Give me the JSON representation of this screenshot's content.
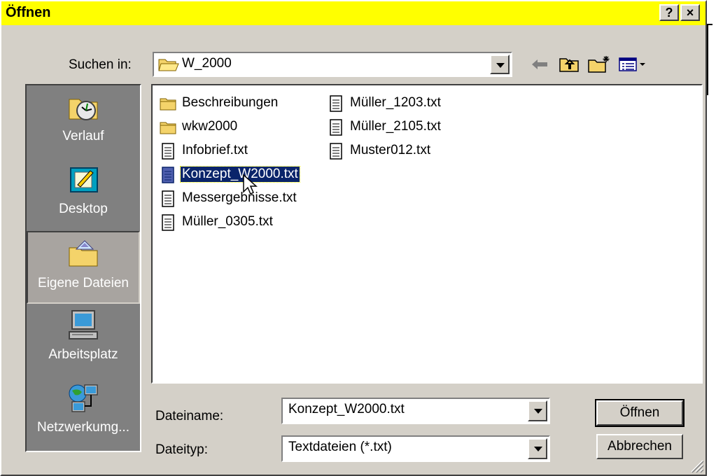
{
  "window": {
    "title": "Öffnen",
    "help_label": "?",
    "close_label": "×"
  },
  "lookin": {
    "label": "Suchen in:",
    "value": "W_2000"
  },
  "toolbar": {
    "icons": [
      "back-arrow-icon",
      "up-folder-icon",
      "new-folder-icon",
      "view-menu-icon"
    ]
  },
  "places": [
    {
      "label": "Verlauf",
      "icon": "history-icon"
    },
    {
      "label": "Desktop",
      "icon": "desktop-icon"
    },
    {
      "label": "Eigene Dateien",
      "icon": "my-documents-icon"
    },
    {
      "label": "Arbeitsplatz",
      "icon": "my-computer-icon"
    },
    {
      "label": "Netzwerkumg...",
      "icon": "network-icon"
    }
  ],
  "files": [
    {
      "name": "Beschreibungen",
      "type": "folder"
    },
    {
      "name": "wkw2000",
      "type": "folder"
    },
    {
      "name": "Infobrief.txt",
      "type": "text"
    },
    {
      "name": "Konzept_W2000.txt",
      "type": "text"
    },
    {
      "name": "Messergebnisse.txt",
      "type": "text"
    },
    {
      "name": "Müller_0305.txt",
      "type": "text"
    },
    {
      "name": "Müller_1203.txt",
      "type": "text"
    },
    {
      "name": "Müller_2105.txt",
      "type": "text"
    },
    {
      "name": "Muster012.txt",
      "type": "text"
    }
  ],
  "filename": {
    "label": "Dateiname:",
    "value": "Konzept_W2000.txt"
  },
  "filetype": {
    "label": "Dateityp:",
    "value": "Textdateien (*.txt)"
  },
  "buttons": {
    "open": "Öffnen",
    "cancel": "Abbrechen"
  },
  "colors": {
    "titlebar": "#ffff00",
    "face": "#d4d0c8",
    "selection": "#0a246a"
  }
}
